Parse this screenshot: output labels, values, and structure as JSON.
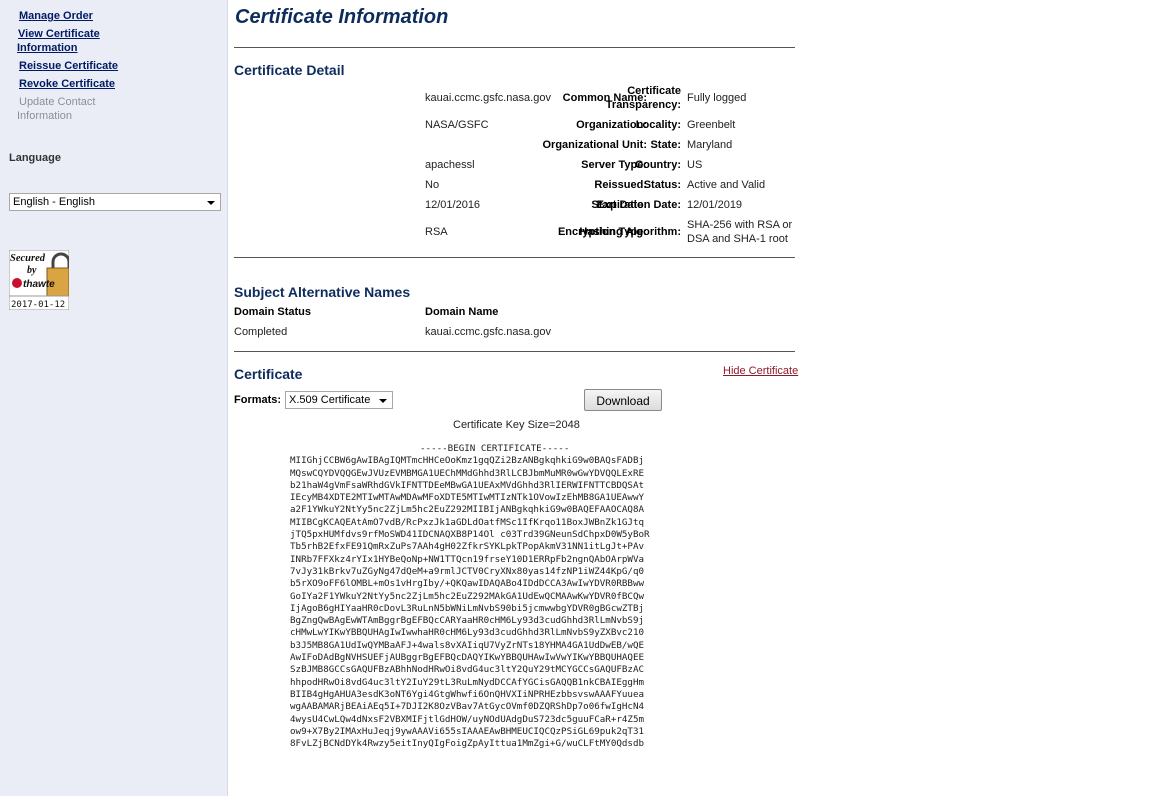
{
  "sidebar": {
    "links": {
      "manage_order": "Manage Order",
      "view_cert_line1": "View Certificate",
      "view_cert_line2": "Information",
      "reissue": "Reissue Certificate",
      "revoke": "Revoke Certificate",
      "update_line1": "Update Contact",
      "update_line2": "Information"
    },
    "language_label": "Language",
    "language_selected": "English - English",
    "seal": {
      "line1": "Secured",
      "line2": "by",
      "brand": "thawte",
      "date": "2017-01-12"
    }
  },
  "page": {
    "title": "Certificate Information"
  },
  "detail": {
    "title": "Certificate Detail",
    "left": [
      {
        "label": "Common Name:",
        "value": "kauai.ccmc.gsfc.nasa.gov"
      },
      {
        "label": "Organization:",
        "value": "NASA/GSFC"
      },
      {
        "label": "Organizational Unit:",
        "value": ""
      },
      {
        "label": "Server Type:",
        "value": "apachessl"
      },
      {
        "label": "Reissued:",
        "value": "No"
      },
      {
        "label": "Start Date:",
        "value": "12/01/2016"
      },
      {
        "label": "Encryption Type:",
        "value": "RSA"
      }
    ],
    "right": [
      {
        "label1": "Certificate",
        "label2": "Transparency:",
        "value": "Fully logged"
      },
      {
        "label": "Locality:",
        "value": "Greenbelt"
      },
      {
        "label": "State:",
        "value": "Maryland"
      },
      {
        "label": "Country:",
        "value": "US"
      },
      {
        "label": "Status:",
        "value": "Active and Valid"
      },
      {
        "label": "Expiration Date:",
        "value": "12/01/2019"
      },
      {
        "label": "Hashing Algorithm:",
        "value1": "SHA-256 with RSA or",
        "value2": "DSA and SHA-1 root"
      }
    ]
  },
  "san": {
    "title": "Subject Alternative Names",
    "headers": {
      "status": "Domain Status",
      "name": "Domain Name"
    },
    "rows": [
      {
        "status": "Completed",
        "name": "kauai.ccmc.gsfc.nasa.gov"
      }
    ]
  },
  "certificate": {
    "title": "Certificate",
    "hide_link": "Hide Certificate",
    "formats_label": "Formats:",
    "format_selected": "X.509 Certificate",
    "download_label": "Download",
    "key_size": "Certificate Key Size=2048",
    "begin": "-----BEGIN CERTIFICATE-----",
    "body": "MIIGhjCCBW6gAwIBAgIQMTmcHHCeOoKmz1gqQZi2BzANBgkqhkiG9w0BAQsFADBj\nMQswCQYDVQQGEwJVUzEVMBMGA1UEChMMdGhhd3RlLCBJbmMuMR0wGwYDVQQLExRE\nb21haW4gVmFsaWRhdGVkIFNTTDEeMBwGA1UEAxMVdGhhd3RlIERWIFNTTCBDQSAt\nIEcyMB4XDTE2MTIwMTAwMDAwMFoXDTE5MTIwMTIzNTk1OVowIzEhMB8GA1UEAwwY\na2F1YWkuY2NtYy5nc2ZjLm5hc2EuZ292MIIBIjANBgkqhkiG9w0BAQEFAAOCAQ8A\nMIIBCgKCAQEAtAmO7vdB/RcPxzJk1aGDLdOatfMSc1IfKrqo11BoxJWBnZk1GJtq\njTQ5pxHUMfdvs9rfMoSWD41IDCNAQXB8P14Ol c03Trd39GNeunSdChpxD0W5yBoR\nTb5rhB2EfxFE91QmRxZuPs7AAh4gH02ZfkrSYKLpkTPopAkmV31NN1itLgJt+PAv\nINRb7FFXkz4rYIx1HYBeQoNp+NW1TTQcn19frseY10D1ERRpFb2ngnQAbOArpWVa\n7vJy31kBrkv7uZGyNg47dQeM+a9rmlJCTV0CryXNx80yas14fzNP1iWZ44KpG/q0\nb5rXO9oFF6lOMBL+mOs1vHrgIby/+QKQawIDAQABo4IDdDCCA3AwIwYDVR0RBBww\nGoIYa2F1YWkuY2NtYy5nc2ZjLm5hc2EuZ292MAkGA1UdEwQCMAAwKwYDVR0fBCQw\nIjAgoB6gHIYaaHR0cDovL3RuLnN5bWNiLmNvbS90bi5jcmwwbgYDVR0gBGcwZTBj\nBgZngQwBAgEwWTAmBggrBgEFBQcCARYaaHR0cHM6Ly93d3cudGhhd3RlLmNvbS9j\ncHMwLwYIKwYBBQUHAgIwIwwhaHR0cHM6Ly93d3cudGhhd3RlLmNvbS9yZXBvc210\nb3J5MB8GA1UdIwQYMBaAFJ+4wals8vXAIiqU7VyZrNTs18YHMA4GA1UdDwEB/wQE\nAwIFoDAdBgNVHSUEFjAUBggrBgEFBQcDAQYIKwYBBQUHAwIwVwYIKwYBBQUHAQEE\nSzBJMB8GCCsGAQUFBzABhhNodHRwOi8vdG4uc3ltY2QuY29tMCYGCCsGAQUFBzAC\nhhpodHRwOi8vdG4uc3ltY2IuY29tL3RuLmNydDCCAfYGCisGAQQB1nkCBAIEggHm\nBIIB4gHgAHUA3esdK3oNT6Ygi4GtgWhwfi6OnQHVXIiNPRHEzbbsvswAAAFYuuea\nwgAABAMARjBEAiAEq5I+7DJI2K8OzVBav7AtGycOVmf0DZQRShDp7o06fwIgHcN4\n4wysU4CwLQw4dNxsF2VBXMIFjtlGdHOW/uyNOdUAdgDuS723dc5guuFCaR+r4Z5m\now9+X7By2IMAxHuJeqj9ywAAAVi655sIAAAEAwBHMEUCIQCQzPSiGL69puk2qT31\n8FvLZjBCNdDYk4Rwzy5eitInyQIgFoigZpAyIttua1MmZgi+G/wuCLFtMY0Qdsdb"
  }
}
